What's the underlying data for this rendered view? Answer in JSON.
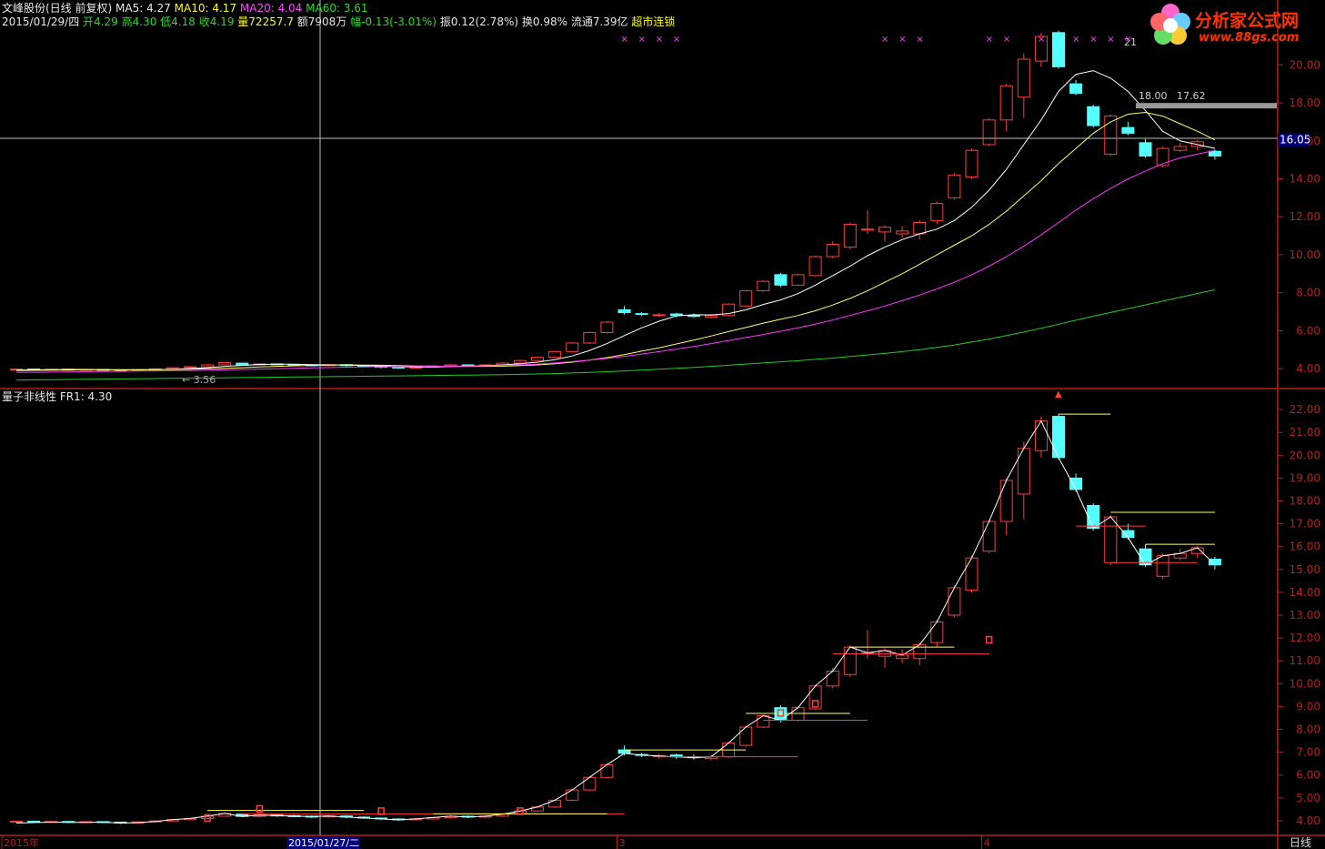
{
  "header1": {
    "title": "文峰股份(日线 前复权)",
    "ma5": "MA5: 4.27",
    "ma10": "MA10: 4.17",
    "ma20": "MA20: 4.04",
    "ma60": "MA60: 3.61"
  },
  "header2": {
    "date": "2015/01/29/四",
    "open": "开4.29",
    "high": "高4.30",
    "low": "低4.18",
    "close": "收4.19",
    "vol": "量72257.7",
    "amount": "额7908万",
    "change": "幅-0.13(-3.01%)",
    "amplitude": "振0.12(2.78%)",
    "turnover": "换0.98%",
    "float": "流通7.39亿",
    "status": "超市连锁"
  },
  "indicator_header": "量子非线性  FR1: 4.30",
  "logo": {
    "name": "分析家公式网",
    "url": "www.88gs.com"
  },
  "crosshair": {
    "price_label": "16.05",
    "date_label": "2015/01/27/二"
  },
  "price_annotations": {
    "low_label": "3.56",
    "peak_label": "21",
    "line1": "18.00",
    "line2": "17.62"
  },
  "x_axis_labels": [
    {
      "label": "2015年",
      "index": 0
    },
    {
      "label": "3",
      "index": 35
    },
    {
      "label": "4",
      "index": 56
    }
  ],
  "period_label": "日线",
  "colors": {
    "up": "#ff3c3c",
    "down": "#55ffff",
    "ma5": "#ffffff",
    "ma10": "#ffff66",
    "ma20": "#ff33ff",
    "ma60": "#22cc22",
    "axis": "#b02020"
  },
  "chart_data": [
    {
      "type": "candlestick",
      "title": "文峰股份(日线 前复权)",
      "ylim": [
        3.0,
        21.5
      ],
      "y_ticks": [
        4.0,
        6.0,
        8.0,
        10.0,
        12.0,
        14.0,
        16.0,
        18.0,
        20.0
      ],
      "candles": [
        [
          3.96,
          3.98,
          3.92,
          4.02
        ],
        [
          3.98,
          3.95,
          3.91,
          4.01
        ],
        [
          3.95,
          3.97,
          3.92,
          4.0
        ],
        [
          3.97,
          3.93,
          3.9,
          3.99
        ],
        [
          3.93,
          3.96,
          3.91,
          3.99
        ],
        [
          3.96,
          3.94,
          3.92,
          3.98
        ],
        [
          3.94,
          3.9,
          3.86,
          3.96
        ],
        [
          3.9,
          3.95,
          3.88,
          3.97
        ],
        [
          3.95,
          3.99,
          3.93,
          4.02
        ],
        [
          3.99,
          4.05,
          3.97,
          4.08
        ],
        [
          4.05,
          4.1,
          4.02,
          4.13
        ],
        [
          4.1,
          4.2,
          4.08,
          4.24
        ],
        [
          4.2,
          4.32,
          4.18,
          4.36
        ],
        [
          4.29,
          4.19,
          4.18,
          4.3
        ],
        [
          4.19,
          4.25,
          4.15,
          4.28
        ],
        [
          4.25,
          4.22,
          4.18,
          4.27
        ],
        [
          4.22,
          4.2,
          4.15,
          4.26
        ],
        [
          4.2,
          4.18,
          4.12,
          4.23
        ],
        [
          4.18,
          4.21,
          4.14,
          4.25
        ],
        [
          4.21,
          4.16,
          4.11,
          4.24
        ],
        [
          4.16,
          4.12,
          4.08,
          4.19
        ],
        [
          4.12,
          4.08,
          4.02,
          4.15
        ],
        [
          4.08,
          4.04,
          3.99,
          4.11
        ],
        [
          4.04,
          4.08,
          4.01,
          4.12
        ],
        [
          4.08,
          4.14,
          4.05,
          4.17
        ],
        [
          4.14,
          4.2,
          4.1,
          4.24
        ],
        [
          4.2,
          4.16,
          4.12,
          4.23
        ],
        [
          4.16,
          4.2,
          4.13,
          4.24
        ],
        [
          4.2,
          4.29,
          4.17,
          4.32
        ],
        [
          4.29,
          4.43,
          4.27,
          4.46
        ],
        [
          4.43,
          4.6,
          4.4,
          4.64
        ],
        [
          4.6,
          4.9,
          4.56,
          4.94
        ],
        [
          4.9,
          5.35,
          4.85,
          5.4
        ],
        [
          5.35,
          5.9,
          5.3,
          5.95
        ],
        [
          5.9,
          6.45,
          5.85,
          6.5
        ],
        [
          7.1,
          6.95,
          6.85,
          7.3
        ],
        [
          6.9,
          6.88,
          6.78,
          6.98
        ],
        [
          6.8,
          6.84,
          6.72,
          6.94
        ],
        [
          6.88,
          6.8,
          6.7,
          6.95
        ],
        [
          6.8,
          6.76,
          6.68,
          6.9
        ],
        [
          6.72,
          6.8,
          6.65,
          6.88
        ],
        [
          6.8,
          7.4,
          6.75,
          7.45
        ],
        [
          7.3,
          8.1,
          7.25,
          8.15
        ],
        [
          8.1,
          8.6,
          8.05,
          8.65
        ],
        [
          8.95,
          8.4,
          8.3,
          9.05
        ],
        [
          8.4,
          8.95,
          8.35,
          9.0
        ],
        [
          8.9,
          9.9,
          8.85,
          9.95
        ],
        [
          9.9,
          10.55,
          9.8,
          10.7
        ],
        [
          10.4,
          11.6,
          10.3,
          11.7
        ],
        [
          11.35,
          11.35,
          11.1,
          12.35
        ],
        [
          11.2,
          11.45,
          10.7,
          11.55
        ],
        [
          11.1,
          11.25,
          10.9,
          11.5
        ],
        [
          11.1,
          11.7,
          10.8,
          11.8
        ],
        [
          11.8,
          12.7,
          11.6,
          12.8
        ],
        [
          13.0,
          14.2,
          12.9,
          14.3
        ],
        [
          14.1,
          15.5,
          14.0,
          15.6
        ],
        [
          15.8,
          17.1,
          15.7,
          17.2
        ],
        [
          17.1,
          18.9,
          16.5,
          19.0
        ],
        [
          18.3,
          20.3,
          17.2,
          20.6
        ],
        [
          20.2,
          21.5,
          19.9,
          21.7
        ],
        [
          21.7,
          19.9,
          19.8,
          21.8
        ],
        [
          19.0,
          18.5,
          18.4,
          19.2
        ],
        [
          17.8,
          16.8,
          16.7,
          17.9
        ],
        [
          15.3,
          17.3,
          15.2,
          17.4
        ],
        [
          16.7,
          16.4,
          16.3,
          17.0
        ],
        [
          15.9,
          15.2,
          15.1,
          16.1
        ],
        [
          14.7,
          15.6,
          14.6,
          15.7
        ],
        [
          15.5,
          15.7,
          15.4,
          15.9
        ],
        [
          15.7,
          15.95,
          15.5,
          16.05
        ],
        [
          15.45,
          15.2,
          15.0,
          15.55
        ]
      ],
      "ma": {
        "MA5": [
          3.92,
          3.94,
          3.95,
          3.96,
          3.96,
          3.95,
          3.94,
          3.94,
          3.95,
          3.97,
          4.0,
          4.05,
          4.12,
          4.17,
          4.22,
          4.23,
          4.23,
          4.21,
          4.2,
          4.19,
          4.17,
          4.14,
          4.1,
          4.08,
          4.09,
          4.11,
          4.13,
          4.16,
          4.2,
          4.26,
          4.34,
          4.47,
          4.67,
          4.96,
          5.32,
          5.74,
          6.15,
          6.5,
          6.78,
          6.84,
          6.83,
          6.9,
          7.1,
          7.38,
          7.62,
          7.95,
          8.4,
          8.9,
          9.4,
          9.95,
          10.4,
          10.8,
          11.1,
          11.35,
          11.8,
          12.5,
          13.4,
          14.5,
          15.8,
          17.1,
          18.6,
          19.5,
          19.7,
          19.3,
          18.6,
          17.6,
          16.5,
          16.0,
          15.8,
          15.6
        ],
        "MA10": [
          3.9,
          3.91,
          3.92,
          3.93,
          3.94,
          3.94,
          3.94,
          3.95,
          3.95,
          3.96,
          3.97,
          3.99,
          4.02,
          4.05,
          4.09,
          4.12,
          4.15,
          4.17,
          4.19,
          4.2,
          4.19,
          4.18,
          4.16,
          4.14,
          4.13,
          4.12,
          4.12,
          4.12,
          4.13,
          4.16,
          4.2,
          4.26,
          4.34,
          4.45,
          4.58,
          4.74,
          4.92,
          5.1,
          5.3,
          5.5,
          5.72,
          5.95,
          6.17,
          6.4,
          6.6,
          6.8,
          7.05,
          7.35,
          7.7,
          8.1,
          8.55,
          9.0,
          9.5,
          10.0,
          10.5,
          11.0,
          11.6,
          12.3,
          13.1,
          13.9,
          14.8,
          15.6,
          16.4,
          17.0,
          17.4,
          17.5,
          17.3,
          16.9,
          16.5,
          16.05
        ],
        "MA20": [
          3.8,
          3.81,
          3.82,
          3.83,
          3.84,
          3.85,
          3.86,
          3.87,
          3.88,
          3.89,
          3.9,
          3.92,
          3.94,
          3.96,
          3.98,
          4.0,
          4.02,
          4.04,
          4.06,
          4.08,
          4.09,
          4.1,
          4.1,
          4.11,
          4.12,
          4.13,
          4.14,
          4.15,
          4.17,
          4.2,
          4.24,
          4.3,
          4.37,
          4.45,
          4.54,
          4.65,
          4.77,
          4.9,
          5.03,
          5.17,
          5.32,
          5.48,
          5.64,
          5.8,
          5.97,
          6.15,
          6.35,
          6.56,
          6.8,
          7.05,
          7.3,
          7.58,
          7.88,
          8.2,
          8.55,
          8.95,
          9.4,
          9.9,
          10.45,
          11.05,
          11.7,
          12.35,
          12.95,
          13.5,
          14.0,
          14.4,
          14.8,
          15.1,
          15.3,
          15.5
        ],
        "MA60": [
          3.4,
          3.41,
          3.42,
          3.43,
          3.44,
          3.45,
          3.46,
          3.47,
          3.48,
          3.49,
          3.5,
          3.51,
          3.52,
          3.53,
          3.54,
          3.55,
          3.56,
          3.57,
          3.58,
          3.59,
          3.6,
          3.61,
          3.62,
          3.63,
          3.64,
          3.65,
          3.66,
          3.67,
          3.68,
          3.7,
          3.72,
          3.74,
          3.77,
          3.8,
          3.84,
          3.88,
          3.92,
          3.97,
          4.02,
          4.07,
          4.12,
          4.18,
          4.24,
          4.3,
          4.36,
          4.42,
          4.49,
          4.56,
          4.64,
          4.72,
          4.8,
          4.9,
          5.0,
          5.12,
          5.25,
          5.4,
          5.56,
          5.74,
          5.93,
          6.13,
          6.34,
          6.55,
          6.76,
          6.96,
          7.16,
          7.36,
          7.56,
          7.76,
          7.96,
          8.15
        ]
      }
    },
    {
      "type": "candlestick",
      "title": "量子非线性",
      "series_label": "FR1: 4.30",
      "ylim": [
        3.6,
        22.4
      ],
      "y_ticks": [
        4.0,
        5.0,
        6.0,
        7.0,
        8.0,
        9.0,
        10.0,
        11.0,
        12.0,
        13.0,
        14.0,
        15.0,
        16.0,
        17.0,
        18.0,
        19.0,
        20.0,
        21.0,
        22.0
      ],
      "fr1_line": [
        3.9,
        3.92,
        3.94,
        3.93,
        3.93,
        3.94,
        3.9,
        3.92,
        3.97,
        4.05,
        4.1,
        4.2,
        4.32,
        4.19,
        4.25,
        4.22,
        4.2,
        4.18,
        4.21,
        4.16,
        4.12,
        4.08,
        4.04,
        4.08,
        4.14,
        4.2,
        4.16,
        4.2,
        4.29,
        4.43,
        4.6,
        4.9,
        5.35,
        5.9,
        6.45,
        6.95,
        6.88,
        6.84,
        6.8,
        6.76,
        6.8,
        7.4,
        8.1,
        8.6,
        8.4,
        8.95,
        9.9,
        10.55,
        11.6,
        11.35,
        11.45,
        11.25,
        11.7,
        12.7,
        14.2,
        15.5,
        17.1,
        18.9,
        20.3,
        21.5,
        19.9,
        18.5,
        16.8,
        17.3,
        16.4,
        15.2,
        15.6,
        15.7,
        15.95,
        15.2
      ]
    }
  ]
}
